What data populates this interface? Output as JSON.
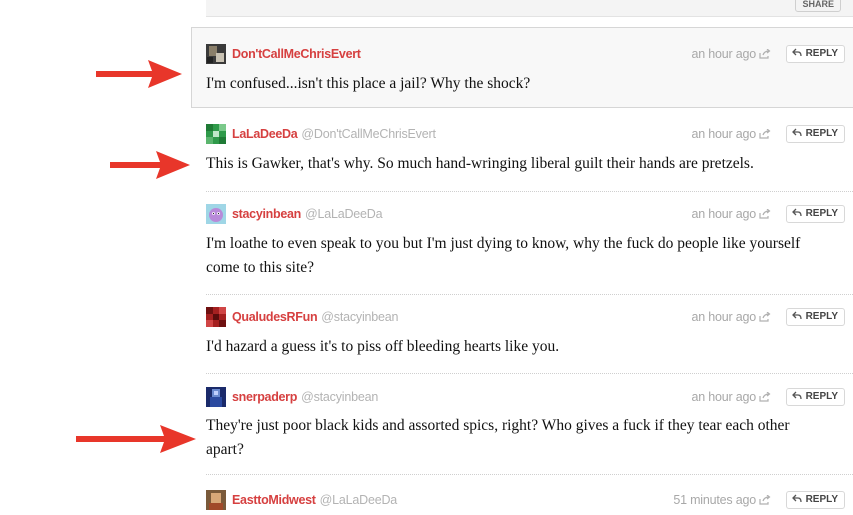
{
  "top": {
    "share_label": "SHARE"
  },
  "comments": [
    {
      "author": "Don'tCallMeChrisEvert",
      "reply_to": "",
      "time": "an hour ago",
      "reply_label": "REPLY",
      "text": "I'm confused...isn't this place a jail? Why the shock?"
    },
    {
      "author": "LaLaDeeDa",
      "reply_to": "@Don'tCallMeChrisEvert",
      "time": "an hour ago",
      "reply_label": "REPLY",
      "text": "This is Gawker, that's why. So much hand-wringing liberal guilt their hands are pretzels."
    },
    {
      "author": "stacyinbean",
      "reply_to": "@LaLaDeeDa",
      "time": "an hour ago",
      "reply_label": "REPLY",
      "text": "I'm loathe to even speak to you but I'm just dying to know, why the fuck do people like yourself come to this site?"
    },
    {
      "author": "QualudesRFun",
      "reply_to": "@stacyinbean",
      "time": "an hour ago",
      "reply_label": "REPLY",
      "text": "I'd hazard a guess it's to piss off bleeding hearts like you."
    },
    {
      "author": "snerpaderp",
      "reply_to": "@stacyinbean",
      "time": "an hour ago",
      "reply_label": "REPLY",
      "text": "They're just poor black kids and assorted spics, right? Who gives a fuck if they tear each other apart?"
    },
    {
      "author": "EasttoMidwest",
      "reply_to": "@LaLaDeeDa",
      "time": "51 minutes ago",
      "reply_label": "REPLY",
      "text": ""
    }
  ],
  "colors": {
    "author": "#d64040",
    "arrow": "#e8362a"
  }
}
